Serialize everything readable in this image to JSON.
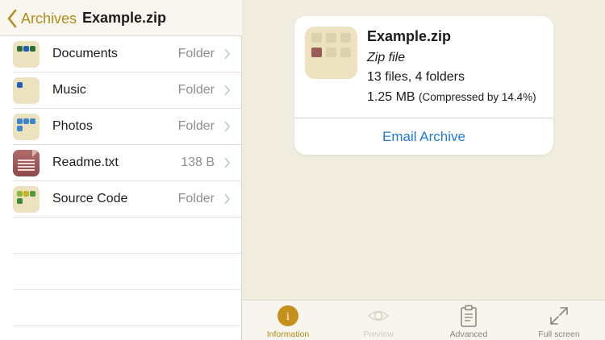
{
  "navbar": {
    "back_label": "Archives",
    "title": "Example.zip"
  },
  "files": [
    {
      "name": "Documents",
      "detail": "Folder",
      "icon": "folder-icon"
    },
    {
      "name": "Music",
      "detail": "Folder",
      "icon": "folder-icon"
    },
    {
      "name": "Photos",
      "detail": "Folder",
      "icon": "folder-icon"
    },
    {
      "name": "Readme.txt",
      "detail": "138 B",
      "icon": "text-file-icon"
    },
    {
      "name": "Source Code",
      "detail": "Folder",
      "icon": "folder-icon"
    }
  ],
  "info": {
    "title": "Example.zip",
    "type": "Zip file",
    "counts": "13 files, 4 folders",
    "size": "1.25 MB",
    "compression": "(Compressed by 14.4%)",
    "email_label": "Email Archive"
  },
  "tabs": [
    {
      "label": "Information",
      "icon": "info-icon",
      "state": "selected"
    },
    {
      "label": "Preview",
      "icon": "eye-icon",
      "state": "disabled"
    },
    {
      "label": "Advanced",
      "icon": "clipboard-icon",
      "state": "normal"
    },
    {
      "label": "Full screen",
      "icon": "expand-icon",
      "state": "normal"
    }
  ],
  "colors": {
    "accent": "#b38b1d",
    "link": "#1f7ad6",
    "background": "#f0ede0"
  }
}
